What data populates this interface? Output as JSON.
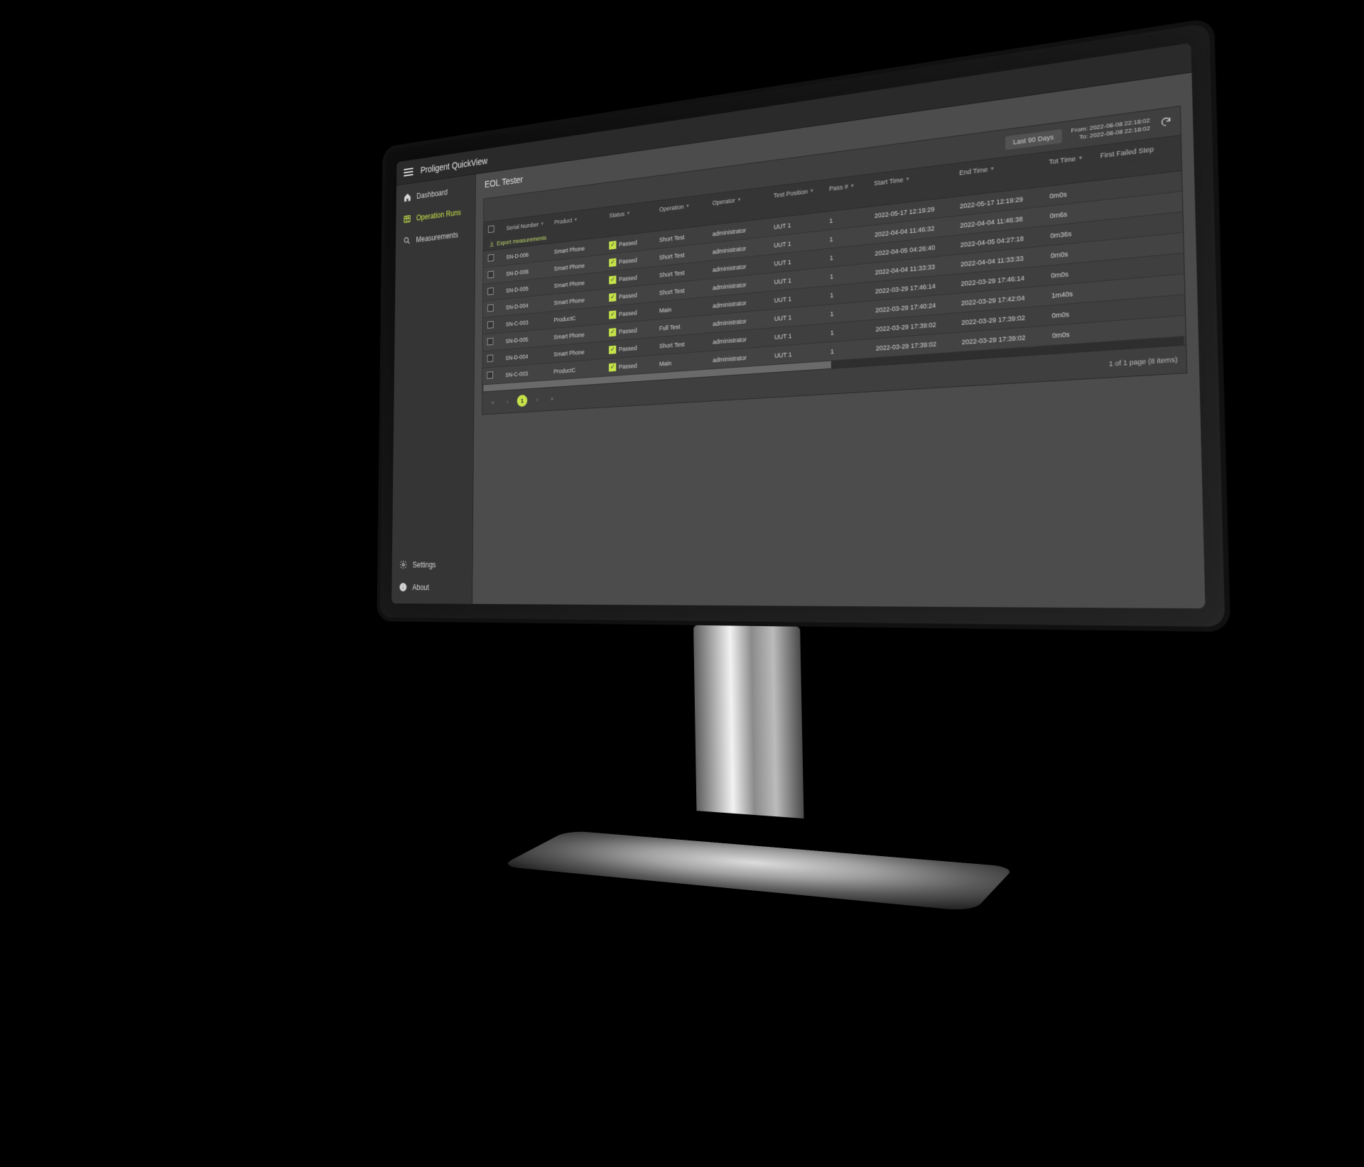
{
  "app_title": "Proligent QuickView",
  "sidebar": {
    "items": [
      {
        "label": "Dashboard"
      },
      {
        "label": "Operation Runs"
      },
      {
        "label": "Measurements"
      }
    ],
    "footer": [
      {
        "label": "Settings"
      },
      {
        "label": "About"
      }
    ]
  },
  "main": {
    "title": "EOL Tester",
    "range_label": "Last 90 Days",
    "date_from": "From: 2022-08-08 22:18:02",
    "date_to": "To: 2022-08-08 22:18:02",
    "export_label": "Export measurements",
    "columns": [
      "Serial Number",
      "Product",
      "Status",
      "Operation",
      "Operator",
      "Test Position",
      "Pass #",
      "Start Time",
      "End Time",
      "Tot Time",
      "First Failed Step"
    ],
    "rows": [
      {
        "sn": "SN-D-006",
        "product": "Smart Phone",
        "status": "Passed",
        "operation": "Short Test",
        "operator": "administrator",
        "position": "UUT 1",
        "pass": "1",
        "start": "2022-05-17 12:19:29",
        "end": "2022-05-17 12:19:29",
        "tot": "0m0s",
        "ffs": ""
      },
      {
        "sn": "SN-D-006",
        "product": "Smart Phone",
        "status": "Passed",
        "operation": "Short Test",
        "operator": "administrator",
        "position": "UUT 1",
        "pass": "1",
        "start": "2022-04-04 11:46:32",
        "end": "2022-04-04 11:46:38",
        "tot": "0m6s",
        "ffs": ""
      },
      {
        "sn": "SN-D-005",
        "product": "Smart Phone",
        "status": "Passed",
        "operation": "Short Test",
        "operator": "administrator",
        "position": "UUT 1",
        "pass": "1",
        "start": "2022-04-05 04:26:40",
        "end": "2022-04-05 04:27:18",
        "tot": "0m36s",
        "ffs": ""
      },
      {
        "sn": "SN-D-004",
        "product": "Smart Phone",
        "status": "Passed",
        "operation": "Short Test",
        "operator": "administrator",
        "position": "UUT 1",
        "pass": "1",
        "start": "2022-04-04 11:33:33",
        "end": "2022-04-04 11:33:33",
        "tot": "0m0s",
        "ffs": ""
      },
      {
        "sn": "SN-C-003",
        "product": "ProductC",
        "status": "Passed",
        "operation": "Main",
        "operator": "administrator",
        "position": "UUT 1",
        "pass": "1",
        "start": "2022-03-29 17:46:14",
        "end": "2022-03-29 17:46:14",
        "tot": "0m0s",
        "ffs": ""
      },
      {
        "sn": "SN-D-005",
        "product": "Smart Phone",
        "status": "Passed",
        "operation": "Full Test",
        "operator": "administrator",
        "position": "UUT 1",
        "pass": "1",
        "start": "2022-03-29 17:40:24",
        "end": "2022-03-29 17:42:04",
        "tot": "1m40s",
        "ffs": ""
      },
      {
        "sn": "SN-D-004",
        "product": "Smart Phone",
        "status": "Passed",
        "operation": "Short Test",
        "operator": "administrator",
        "position": "UUT 1",
        "pass": "1",
        "start": "2022-03-29 17:39:02",
        "end": "2022-03-29 17:39:02",
        "tot": "0m0s",
        "ffs": ""
      },
      {
        "sn": "SN-C-003",
        "product": "ProductC",
        "status": "Passed",
        "operation": "Main",
        "operator": "administrator",
        "position": "UUT 1",
        "pass": "1",
        "start": "2022-03-29 17:39:02",
        "end": "2022-03-29 17:39:02",
        "tot": "0m0s",
        "ffs": ""
      }
    ],
    "pager": {
      "current": "1",
      "summary": "1 of 1 page (8 items)"
    }
  }
}
